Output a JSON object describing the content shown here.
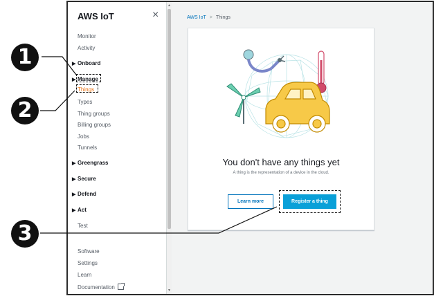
{
  "sidebar": {
    "title": "AWS IoT",
    "close_icon": "×",
    "top_links": [
      "Monitor",
      "Activity"
    ],
    "sections": {
      "onboard": "Onboard",
      "manage": "Manage",
      "greengrass": "Greengrass",
      "secure": "Secure",
      "defend": "Defend",
      "act": "Act"
    },
    "manage_items": [
      "Things",
      "Types",
      "Thing groups",
      "Billing groups",
      "Jobs",
      "Tunnels"
    ],
    "test": "Test",
    "bottom_links": [
      "Software",
      "Settings",
      "Learn",
      "Documentation"
    ],
    "active_item": "Things"
  },
  "breadcrumb": {
    "root": "AWS IoT",
    "separator": ">",
    "current": "Things"
  },
  "empty_state": {
    "title": "You don't have any things yet",
    "subtitle": "A thing is the representation of a device in the cloud.",
    "learn_more_label": "Learn more",
    "register_label": "Register a thing",
    "illustration": "iot-devices-illustration"
  },
  "callouts": [
    "1",
    "2",
    "3"
  ],
  "colors": {
    "active_nav": "#ec7211",
    "primary_button": "#0aa0d8",
    "link": "#0073bb",
    "background": "#f2f3f3"
  },
  "icons": [
    "close-icon",
    "caret-right-icon",
    "external-link-icon"
  ]
}
